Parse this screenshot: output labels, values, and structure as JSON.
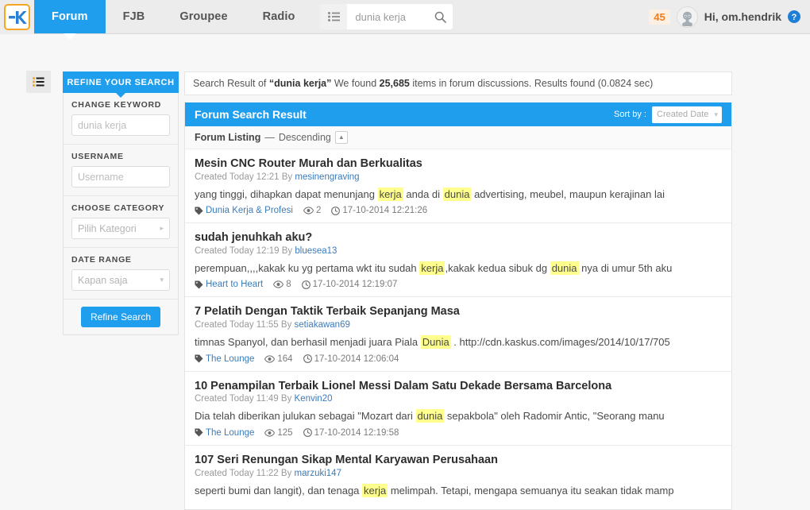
{
  "topnav": {
    "logo_alt": "kaskus-logo",
    "tabs": [
      {
        "label": "Forum",
        "active": true
      },
      {
        "label": "FJB",
        "active": false
      },
      {
        "label": "Groupee",
        "active": false
      },
      {
        "label": "Radio",
        "active": false
      }
    ],
    "search": {
      "value": "dunia kerja",
      "placeholder": "dunia kerja"
    },
    "notification_count": "45",
    "greeting": "Hi, om.hendrik",
    "accent_color": "#1f9eee",
    "badge_color": "#ef7d20"
  },
  "sidebar": {
    "header": "REFINE YOUR SEARCH",
    "groups": [
      {
        "label": "CHANGE KEYWORD",
        "type": "input",
        "value": "dunia kerja",
        "placeholder": "dunia kerja"
      },
      {
        "label": "USERNAME",
        "type": "input",
        "value": "",
        "placeholder": "Username"
      },
      {
        "label": "CHOOSE CATEGORY",
        "type": "select",
        "value": "Pilih Kategori"
      },
      {
        "label": "DATE RANGE",
        "type": "select",
        "value": "Kapan saja"
      }
    ],
    "refine_button": "Refine Search"
  },
  "main": {
    "summary": {
      "prefix": "Search Result of ",
      "query": "“dunia kerja”",
      "middle": " We found ",
      "count": "25,685",
      "suffix": " items in forum discussions. Results found (0.0824 sec)"
    },
    "panel_title": "Forum Search Result",
    "sort_label": "Sort by :",
    "sort_value": "Created Date",
    "listing_label": "Forum Listing",
    "listing_dash": "—",
    "listing_order": "Descending",
    "results": [
      {
        "title": "Mesin CNC Router Murah dan Berkualitas",
        "created": "Created Today 12:21 By",
        "author": "mesinengraving",
        "snippet_parts": [
          {
            "text": "yang tinggi, dihapkan dapat menunjang ",
            "hl": false
          },
          {
            "text": "kerja",
            "hl": true
          },
          {
            "text": " anda di ",
            "hl": false
          },
          {
            "text": "dunia",
            "hl": true
          },
          {
            "text": " advertising, meubel, maupun kerajinan lai",
            "hl": false
          }
        ],
        "category": "Dunia Kerja & Profesi",
        "views": "2",
        "timestamp": "17-10-2014 12:21:26"
      },
      {
        "title": "sudah jenuhkah aku?",
        "created": "Created Today 12:19 By",
        "author": "bluesea13",
        "snippet_parts": [
          {
            "text": "perempuan,,,,kakak ku yg pertama wkt itu sudah ",
            "hl": false
          },
          {
            "text": "kerja",
            "hl": true
          },
          {
            "text": ",kakak kedua sibuk dg ",
            "hl": false
          },
          {
            "text": "dunia",
            "hl": true
          },
          {
            "text": " nya di umur 5th aku",
            "hl": false
          }
        ],
        "category": "Heart to Heart",
        "views": "8",
        "timestamp": "17-10-2014 12:19:07"
      },
      {
        "title": "7 Pelatih Dengan Taktik Terbaik Sepanjang Masa",
        "created": "Created Today 11:55 By",
        "author": "setiakawan69",
        "snippet_parts": [
          {
            "text": "timnas Spanyol, dan berhasil menjadi juara Piala ",
            "hl": false
          },
          {
            "text": "Dunia",
            "hl": true
          },
          {
            "text": " . http://cdn.kaskus.com/images/2014/10/17/705",
            "hl": false
          }
        ],
        "category": "The Lounge",
        "views": "164",
        "timestamp": "17-10-2014 12:06:04"
      },
      {
        "title": "10 Penampilan Terbaik Lionel Messi Dalam Satu Dekade Bersama Barcelona",
        "created": "Created Today 11:49 By",
        "author": "Kenvin20",
        "snippet_parts": [
          {
            "text": "Dia telah diberikan julukan sebagai \"Mozart dari ",
            "hl": false
          },
          {
            "text": "dunia",
            "hl": true
          },
          {
            "text": " sepakbola\" oleh Radomir Antic, \"Seorang manu",
            "hl": false
          }
        ],
        "category": "The Lounge",
        "views": "125",
        "timestamp": "17-10-2014 12:19:58"
      },
      {
        "title": "107 Seri Renungan Sikap Mental Karyawan Perusahaan",
        "created": "Created Today 11:22 By",
        "author": "marzuki147",
        "snippet_parts": [
          {
            "text": "seperti bumi dan langit), dan tenaga ",
            "hl": false
          },
          {
            "text": "kerja",
            "hl": true
          },
          {
            "text": " melimpah. Tetapi, mengapa semuanya itu seakan tidak mamp",
            "hl": false
          }
        ],
        "category": "",
        "views": "",
        "timestamp": ""
      }
    ]
  }
}
